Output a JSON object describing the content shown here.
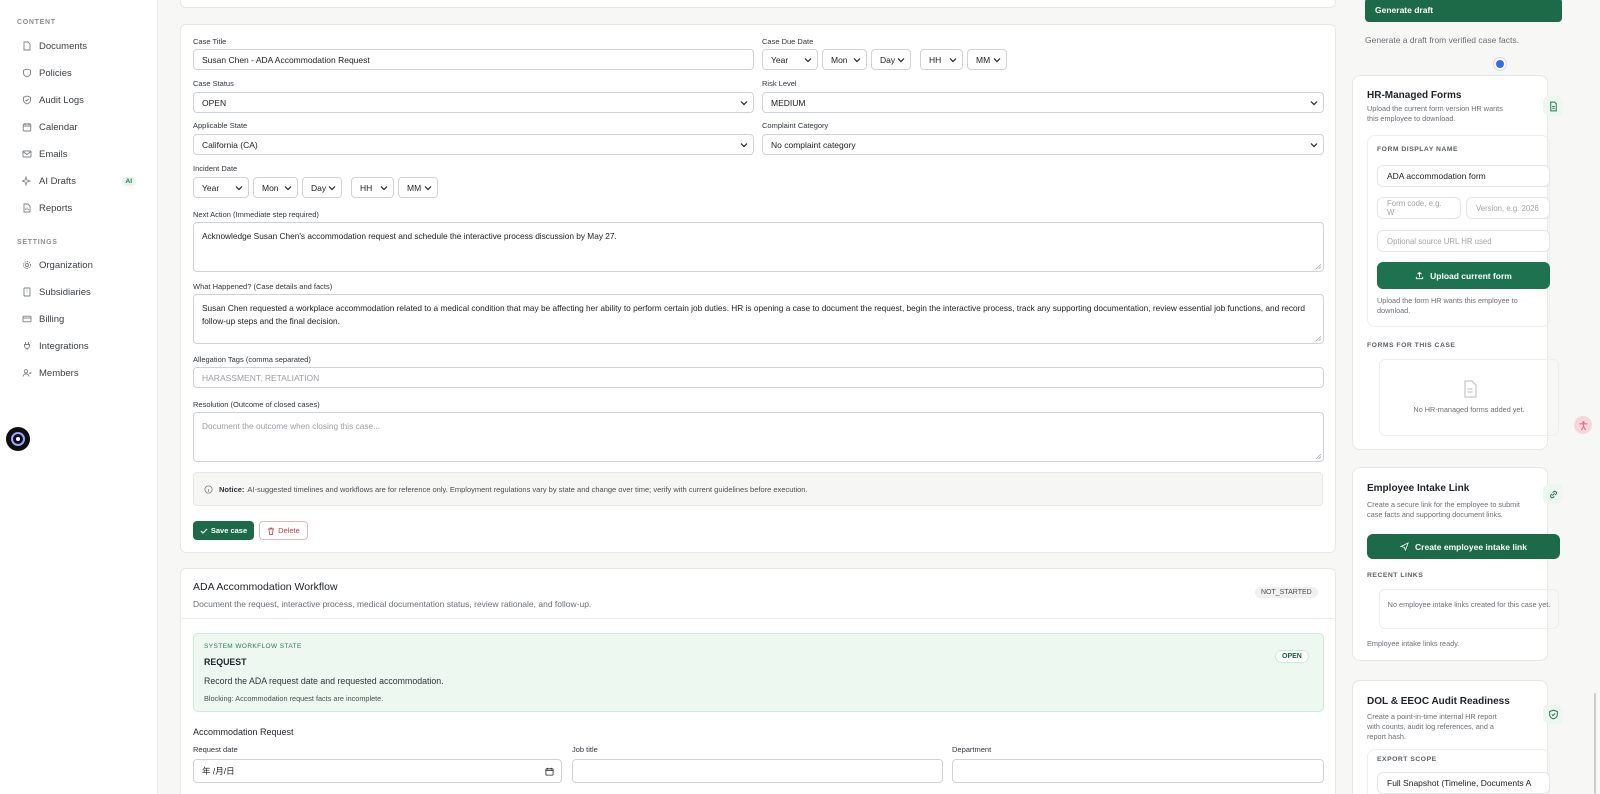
{
  "sidebar": {
    "content_title": "CONTENT",
    "settings_title": "SETTINGS",
    "content_items": [
      {
        "label": "Documents",
        "icon": "document-icon"
      },
      {
        "label": "Policies",
        "icon": "shield-icon"
      },
      {
        "label": "Audit Logs",
        "icon": "shield-check-icon"
      },
      {
        "label": "Calendar",
        "icon": "calendar-icon"
      },
      {
        "label": "Emails",
        "icon": "mail-icon"
      },
      {
        "label": "AI Drafts",
        "icon": "sparkles-icon",
        "badge": "AI"
      },
      {
        "label": "Reports",
        "icon": "report-icon"
      }
    ],
    "settings_items": [
      {
        "label": "Organization",
        "icon": "gear-icon"
      },
      {
        "label": "Subsidiaries",
        "icon": "building-icon"
      },
      {
        "label": "Billing",
        "icon": "card-icon"
      },
      {
        "label": "Integrations",
        "icon": "plug-icon"
      },
      {
        "label": "Members",
        "icon": "users-icon"
      }
    ]
  },
  "case_form": {
    "title_label": "Case Title",
    "title_value": "Susan Chen - ADA Accommodation Request",
    "due_label": "Case Due Date",
    "date_parts": {
      "year": "Year",
      "mon": "Mon",
      "day": "Day",
      "hh": "HH",
      "mm": "MM"
    },
    "status_label": "Case Status",
    "status_value": "OPEN",
    "risk_label": "Risk Level",
    "risk_value": "MEDIUM",
    "state_label": "Applicable State",
    "state_value": "California (CA)",
    "category_label": "Complaint Category",
    "category_value": "No complaint category",
    "incident_label": "Incident Date",
    "next_action_label": "Next Action (Immediate step required)",
    "next_action_value": "Acknowledge Susan Chen's accommodation request and schedule the interactive process discussion by May 27.",
    "what_happened_label": "What Happened? (Case details and facts)",
    "what_happened_value": "Susan Chen requested a workplace accommodation related to a medical condition that may be affecting her ability to perform certain job duties. HR is opening a case to document the request, begin the interactive process, track any supporting documentation, review essential job functions, and record follow-up steps and the final decision.",
    "tags_label": "Allegation Tags (comma separated)",
    "tags_placeholder": "HARASSMENT, RETALIATION",
    "resolution_label": "Resolution (Outcome of closed cases)",
    "resolution_placeholder": "Document the outcome when closing this case...",
    "notice_bold": "Notice:",
    "notice_text": "AI-suggested timelines and workflows are for reference only. Employment regulations vary by state and change over time; verify with current guidelines before execution.",
    "save_label": "Save case",
    "delete_label": "Delete"
  },
  "workflow": {
    "title": "ADA Accommodation Workflow",
    "subtitle": "Document the request, interactive process, medical documentation status, review rationale, and follow-up.",
    "status": "NOT_STARTED",
    "state_caption": "SYSTEM WORKFLOW STATE",
    "state_name": "REQUEST",
    "state_badge": "OPEN",
    "state_desc": "Record the ADA request date and requested accommodation.",
    "state_blocking": "Blocking: Accommodation request facts are incomplete.",
    "section_title": "Accommodation Request",
    "request_date_label": "Request date",
    "request_date_value": "年 /月/日",
    "job_title_label": "Job title",
    "department_label": "Department"
  },
  "right": {
    "generate_btn": "Generate draft",
    "generate_sub": "Generate a draft from verified case facts.",
    "forms": {
      "title": "HR-Managed Forms",
      "subtitle": "Upload the current form version HR wants this employee to download.",
      "display_name_caption": "FORM DISPLAY NAME",
      "display_name_value": "ADA accommodation form",
      "code_placeholder": "Form code, e.g. W",
      "version_placeholder": "Version, e.g. 2026",
      "url_placeholder": "Optional source URL HR used",
      "upload_btn": "Upload current form",
      "upload_note": "Upload the form HR wants this employee to download.",
      "case_forms_caption": "FORMS FOR THIS CASE",
      "empty_text": "No HR-managed forms added yet."
    },
    "intake": {
      "title": "Employee Intake Link",
      "subtitle": "Create a secure link for the employee to submit case facts and supporting document links.",
      "create_btn": "Create employee intake link",
      "recent_caption": "RECENT LINKS",
      "empty_text": "No employee intake links created for this case yet.",
      "ready_text": "Employee intake links ready."
    },
    "audit": {
      "title": "DOL & EEOC Audit Readiness",
      "subtitle": "Create a point-in-time internal HR report with counts, audit log references, and a report hash.",
      "scope_caption": "EXPORT SCOPE",
      "scope_value": "Full Snapshot (Timeline, Documents A"
    }
  },
  "colors": {
    "accent": "#1c6a48",
    "danger": "#c43c3c",
    "workflow_bg": "#edf8f1"
  }
}
